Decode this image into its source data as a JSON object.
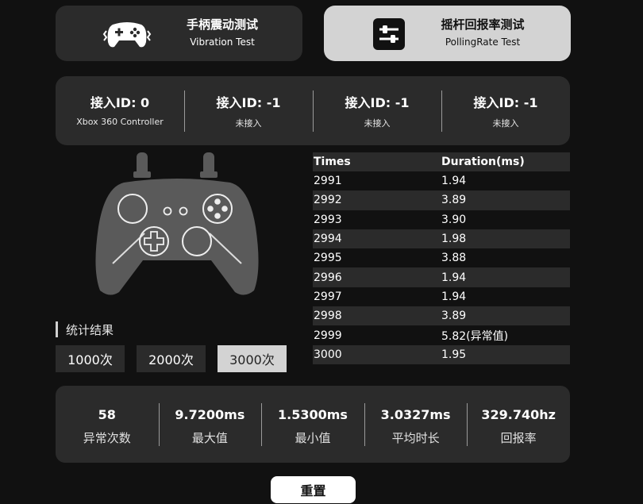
{
  "tabs": {
    "vibration": {
      "title": "手柄震动测试",
      "subtitle": "Vibration Test",
      "icon": "gamepad-vibration-icon"
    },
    "polling": {
      "title": "摇杆回报率测试",
      "subtitle": "PollingRate Test",
      "icon": "sliders-icon"
    }
  },
  "slots": [
    {
      "id": "接入ID: 0",
      "name": "Xbox 360 Controller"
    },
    {
      "id": "接入ID: -1",
      "name": "未接入"
    },
    {
      "id": "接入ID: -1",
      "name": "未接入"
    },
    {
      "id": "接入ID: -1",
      "name": "未接入"
    }
  ],
  "stats": {
    "label": "统计结果",
    "counts": [
      "1000次",
      "2000次",
      "3000次"
    ],
    "selected": "3000次"
  },
  "table": {
    "headers": [
      "Times",
      "Duration(ms)"
    ],
    "rows": [
      [
        "2991",
        "1.94"
      ],
      [
        "2992",
        "3.89"
      ],
      [
        "2993",
        "3.90"
      ],
      [
        "2994",
        "1.98"
      ],
      [
        "2995",
        "3.88"
      ],
      [
        "2996",
        "1.94"
      ],
      [
        "2997",
        "1.94"
      ],
      [
        "2998",
        "3.89"
      ],
      [
        "2999",
        "5.82(异常值)"
      ],
      [
        "3000",
        "1.95"
      ]
    ]
  },
  "summary": [
    {
      "value": "58",
      "label": "异常次数"
    },
    {
      "value": "9.7200ms",
      "label": "最大值"
    },
    {
      "value": "1.5300ms",
      "label": "最小值"
    },
    {
      "value": "3.0327ms",
      "label": "平均时长"
    },
    {
      "value": "329.740hz",
      "label": "回报率"
    }
  ],
  "reset_label": "重置",
  "colors": {
    "background": "#111111",
    "panel": "#2b2b2b",
    "active": "#d3d3d3",
    "controller": "#5a5a5a"
  }
}
